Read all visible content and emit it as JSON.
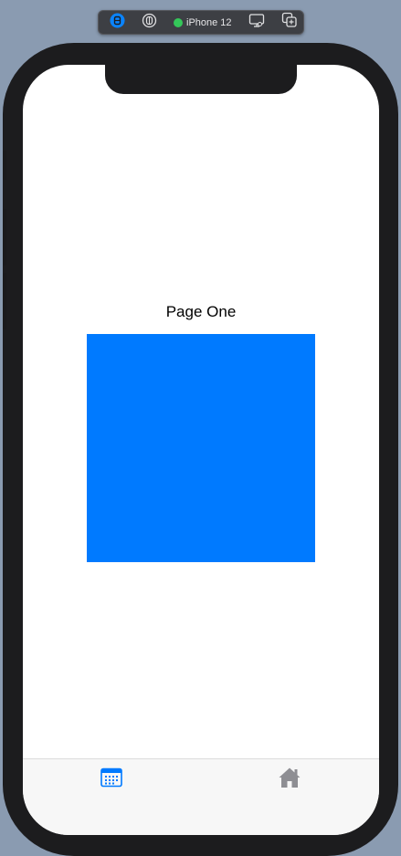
{
  "toolbar": {
    "device_name": "iPhone 12",
    "status_color": "#34c759",
    "icons": [
      "live-preview-icon",
      "inspect-icon",
      "device-settings-icon",
      "duplicate-preview-icon"
    ]
  },
  "page": {
    "title": "Page One",
    "square_color": "#007aff"
  },
  "tab_bar": {
    "items": [
      {
        "icon": "calendar-icon",
        "selected": true,
        "color": "#007aff"
      },
      {
        "icon": "house-icon",
        "selected": false,
        "color": "#8e8e93"
      }
    ]
  }
}
